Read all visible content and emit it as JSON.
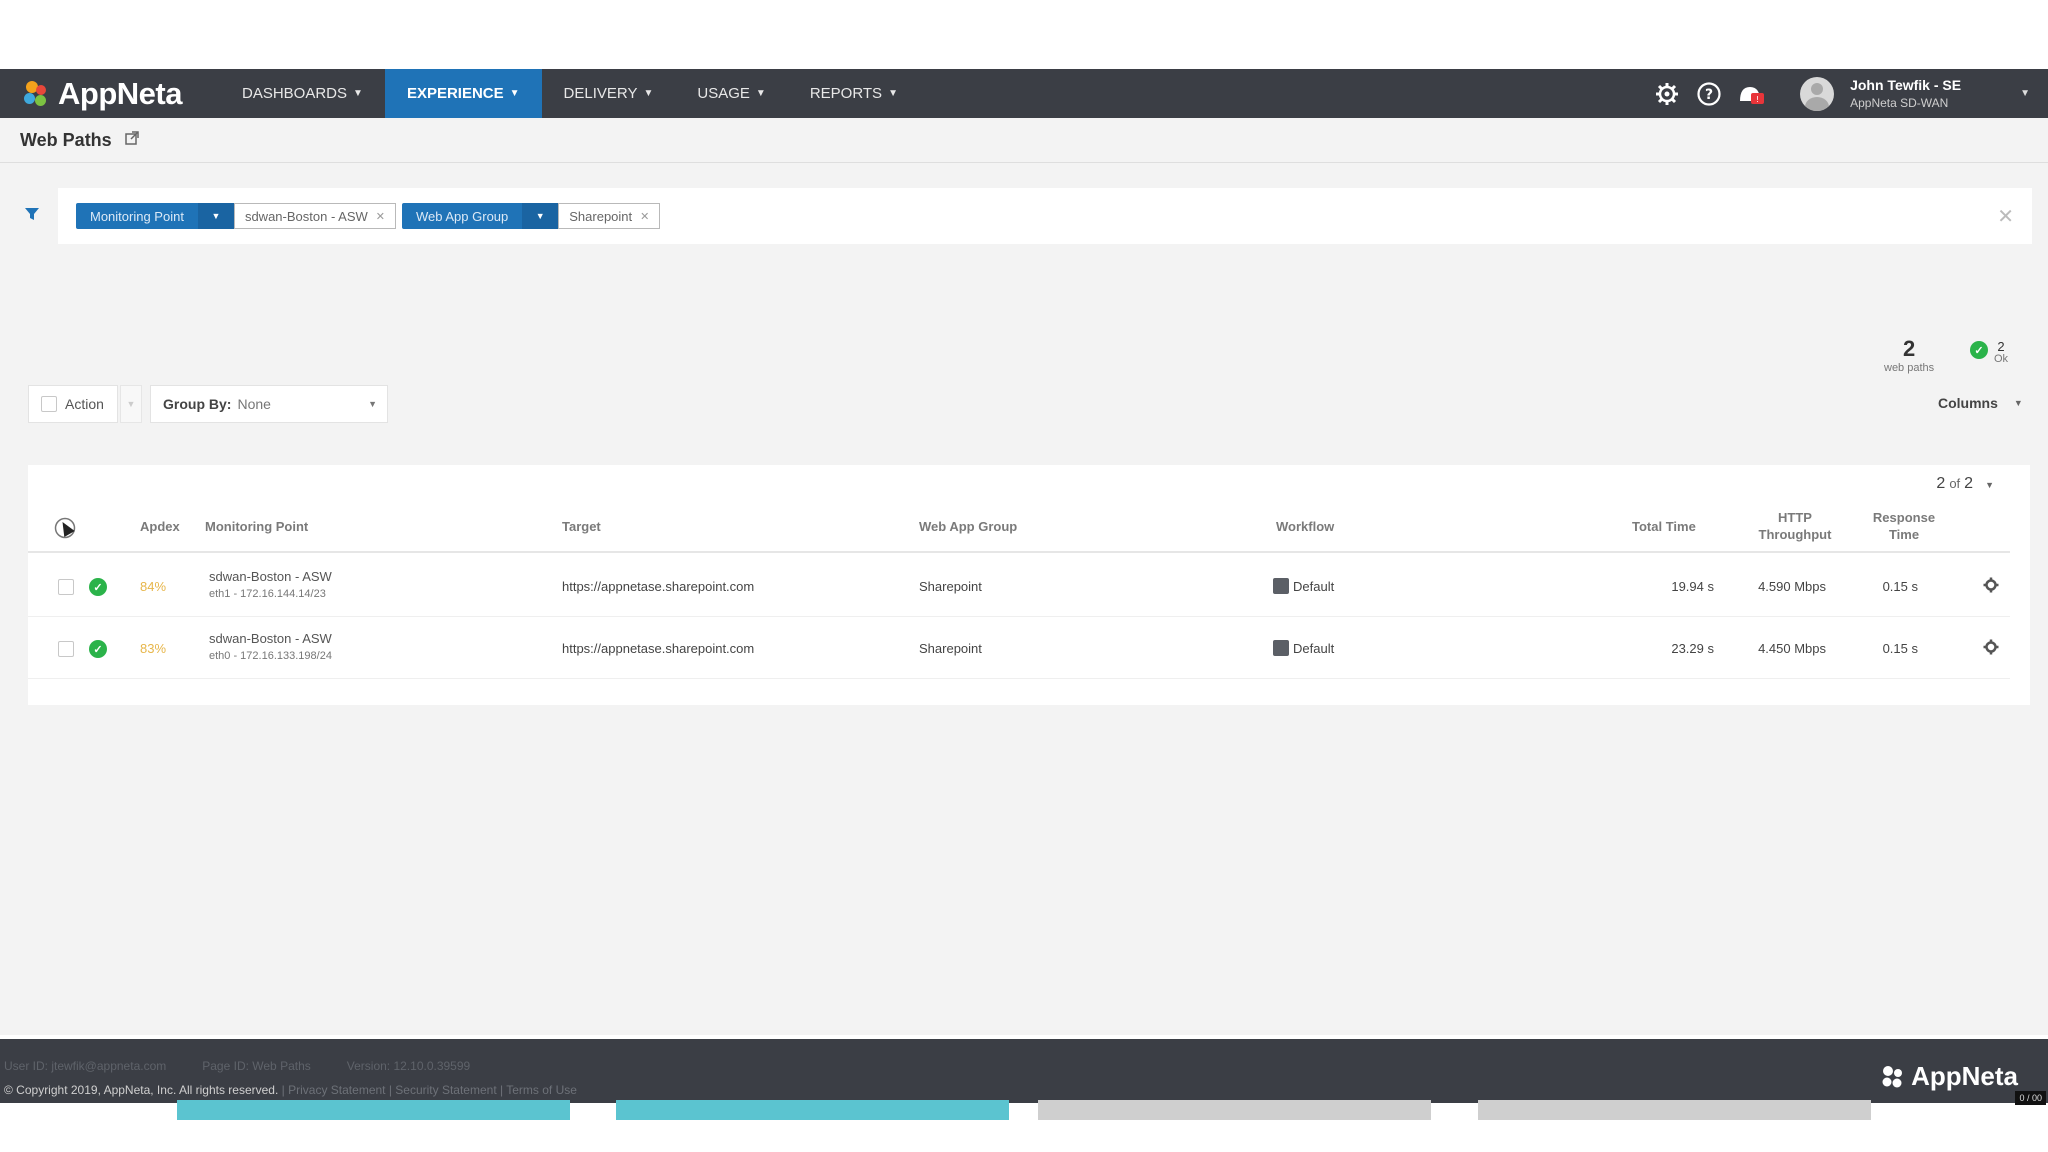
{
  "app": {
    "logo_text": "AppNeta",
    "nav": [
      {
        "label": "DASHBOARDS",
        "active": false
      },
      {
        "label": "EXPERIENCE",
        "active": true
      },
      {
        "label": "DELIVERY",
        "active": false
      },
      {
        "label": "USAGE",
        "active": false
      },
      {
        "label": "REPORTS",
        "active": false
      }
    ],
    "user": {
      "name": "John Tewfik - SE",
      "org": "AppNeta SD-WAN"
    },
    "icons": [
      "gear-icon",
      "help-icon",
      "notifications-icon",
      "avatar-icon"
    ]
  },
  "page": {
    "title": "Web Paths"
  },
  "filters": [
    {
      "label": "Monitoring Point",
      "value": "sdwan-Boston - ASW"
    },
    {
      "label": "Web App Group",
      "value": "Sharepoint"
    }
  ],
  "stats": {
    "count": "2",
    "count_label": "web paths",
    "ok_count": "2",
    "ok_label": "Ok"
  },
  "toolbar": {
    "action_label": "Action",
    "groupby_label": "Group By:",
    "groupby_value": "None",
    "columns_label": "Columns"
  },
  "pager": {
    "current": "2",
    "of": "of",
    "total": "2"
  },
  "table": {
    "headers": {
      "apdex": "Apdex",
      "monitoring_point": "Monitoring Point",
      "target": "Target",
      "web_app_group": "Web App Group",
      "workflow": "Workflow",
      "total_time": "Total Time",
      "http_throughput_1": "HTTP",
      "http_throughput_2": "Throughput",
      "response_time_1": "Response",
      "response_time_2": "Time"
    },
    "rows": [
      {
        "apdex": "84%",
        "mp_name": "sdwan-Boston - ASW",
        "mp_sub": "eth1 - 172.16.144.14/23",
        "target": "https://appnetase.sharepoint.com",
        "group": "Sharepoint",
        "workflow": "Default",
        "total_time": "19.94 s",
        "throughput": "4.590 Mbps",
        "response": "0.15 s"
      },
      {
        "apdex": "83%",
        "mp_name": "sdwan-Boston - ASW",
        "mp_sub": "eth0 - 172.16.133.198/24",
        "target": "https://appnetase.sharepoint.com",
        "group": "Sharepoint",
        "workflow": "Default",
        "total_time": "23.29 s",
        "throughput": "4.450 Mbps",
        "response": "0.15 s"
      }
    ]
  },
  "footer": {
    "user_id": "User ID: jtewfik@appneta.com",
    "page_id": "Page ID: Web Paths",
    "version": "Version: 12.10.0.39599",
    "copyright": "© Copyright 2019, AppNeta, Inc. All rights reserved.",
    "links": "| Privacy Statement | Security Statement | Terms of Use",
    "logo_text": "AppNeta",
    "badge": "0 / 00"
  },
  "progress": [
    {
      "state": "complete",
      "color": "#5bc4d0"
    },
    {
      "state": "complete",
      "color": "#5bc4d0"
    },
    {
      "state": "pending",
      "color": "#cfcfcf"
    },
    {
      "state": "pending",
      "color": "#cfcfcf"
    }
  ],
  "colors": {
    "nav_bg": "#3b3e45",
    "accent": "#1f73b7",
    "ok": "#2bb34a",
    "apdex": "#e7b64a"
  }
}
